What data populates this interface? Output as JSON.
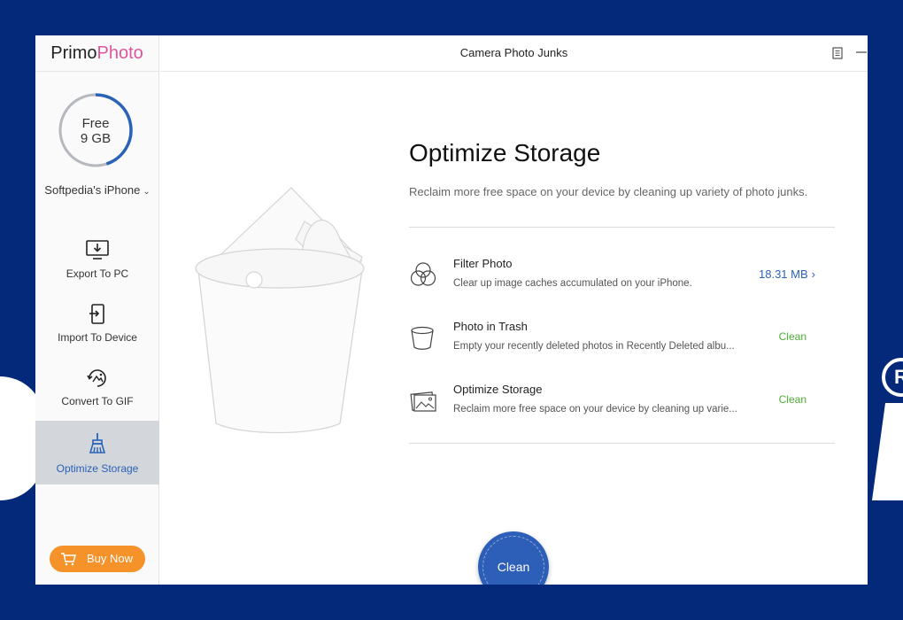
{
  "app": {
    "logo_primo": "Primo",
    "logo_photo": "Photo",
    "window_title": "Camera Photo Junks"
  },
  "storage": {
    "label": "Free",
    "amount": "9 GB",
    "used_fraction": 0.45
  },
  "device": {
    "name": "Softpedia's iPhone"
  },
  "nav": {
    "items": [
      {
        "label": "Export To PC",
        "icon": "export-to-pc-icon"
      },
      {
        "label": "Import To Device",
        "icon": "import-to-device-icon"
      },
      {
        "label": "Convert To GIF",
        "icon": "convert-to-gif-icon"
      },
      {
        "label": "Optimize Storage",
        "icon": "optimize-storage-icon",
        "active": true
      }
    ]
  },
  "buy": {
    "label": "Buy Now"
  },
  "main": {
    "title": "Optimize Storage",
    "subtitle": "Reclaim more free space on your device by cleaning up variety of photo junks.",
    "items": [
      {
        "title": "Filter Photo",
        "desc": "Clear up image caches accumulated on your iPhone.",
        "size": "18.31 MB",
        "icon": "filter-circles-icon"
      },
      {
        "title": "Photo in Trash",
        "desc": "Empty your recently deleted photos in Recently Deleted albu...",
        "status": "Clean",
        "icon": "trash-icon"
      },
      {
        "title": "Optimize Storage",
        "desc": "Reclaim more free space on your device by cleaning up varie...",
        "status": "Clean",
        "icon": "photos-icon"
      }
    ],
    "clean_button": "Clean"
  },
  "colors": {
    "accent_blue": "#2a62b8",
    "clean_green": "#4caf36",
    "buy_orange": "#f5922a",
    "background": "#04297a",
    "logo_pink": "#e0559b"
  }
}
